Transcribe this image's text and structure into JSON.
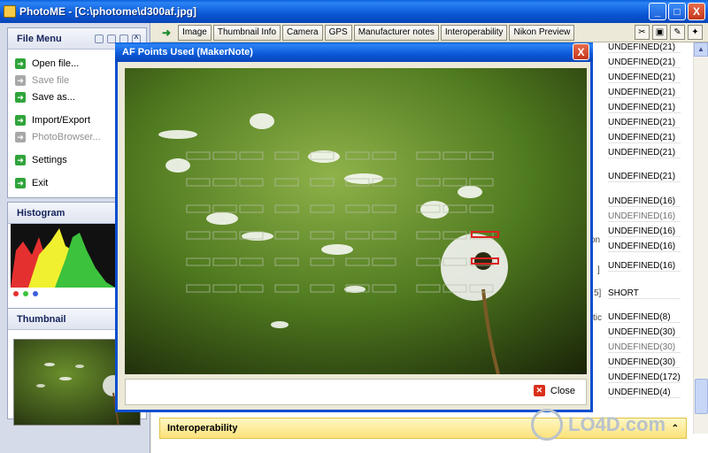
{
  "window": {
    "title": "PhotoME - [C:\\photome\\d300af.jpg]",
    "buttons": [
      "_",
      "□",
      "X"
    ]
  },
  "file_menu": {
    "title": "File Menu",
    "items": [
      {
        "label": "Open file...",
        "enabled": true
      },
      {
        "label": "Save file",
        "enabled": false
      },
      {
        "label": "Save as...",
        "enabled": true
      },
      {
        "label": "Import/Export",
        "enabled": true
      },
      {
        "label": "PhotoBrowser...",
        "enabled": false
      },
      {
        "label": "Settings",
        "enabled": true
      },
      {
        "label": "Exit",
        "enabled": true
      }
    ]
  },
  "histogram": {
    "title": "Histogram",
    "channels": [
      "#e53030",
      "#3cc23c",
      "#3a5fe0"
    ]
  },
  "thumbnail": {
    "title": "Thumbnail"
  },
  "tabs": [
    "Image",
    "Thumbnail Info",
    "Camera",
    "GPS",
    "Manufacturer notes",
    "Interoperability",
    "Nikon Preview"
  ],
  "values": [
    {
      "text": "UNDEFINED(21)",
      "grey": false
    },
    {
      "text": "UNDEFINED(21)",
      "grey": false
    },
    {
      "text": "UNDEFINED(21)",
      "grey": false
    },
    {
      "text": "UNDEFINED(21)",
      "grey": false
    },
    {
      "text": "UNDEFINED(21)",
      "grey": false
    },
    {
      "text": "UNDEFINED(21)",
      "grey": false
    },
    {
      "text": "UNDEFINED(21)",
      "grey": false
    },
    {
      "text": "UNDEFINED(21)",
      "grey": false
    },
    {
      "text": "UNDEFINED(21)",
      "grey": false
    },
    {
      "text": "UNDEFINED(16)",
      "grey": false
    },
    {
      "text": "UNDEFINED(16)",
      "grey": true
    },
    {
      "text": "UNDEFINED(16)",
      "grey": false
    },
    {
      "text": "UNDEFINED(16)",
      "grey": false
    },
    {
      "text": "UNDEFINED(16)",
      "grey": false
    },
    {
      "text": "SHORT",
      "grey": false
    },
    {
      "text": "UNDEFINED(8)",
      "grey": false
    },
    {
      "text": "UNDEFINED(30)",
      "grey": false
    },
    {
      "text": "UNDEFINED(30)",
      "grey": true
    },
    {
      "text": "UNDEFINED(30)",
      "grey": false
    },
    {
      "text": "UNDEFINED(172)",
      "grey": false
    },
    {
      "text": "UNDEFINED(4)",
      "grey": false
    }
  ],
  "mid_fragments": [
    "on",
    "]",
    "5]",
    "ctic"
  ],
  "dialog": {
    "title": "AF Points Used (MakerNote)",
    "close_label": "Close"
  },
  "interop_section": {
    "title": "Interoperability"
  },
  "watermark": {
    "text": "LO4D.com"
  }
}
